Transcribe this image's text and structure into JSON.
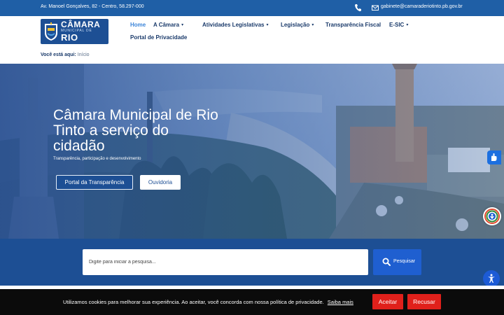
{
  "topbar": {
    "address": "Av. Manoel Gonçalves, 82 - Centro, 58.297-000",
    "email": "gabinete@camaraderiotinto.pb.gov.br",
    "icons": [
      "phone-icon",
      "mail-icon"
    ]
  },
  "logo": {
    "line1": "CÂMARA",
    "line2": "MUNICIPAL DE",
    "line3": "RIO TINTO"
  },
  "nav": {
    "items": [
      {
        "label": "Home",
        "active": true,
        "dropdown": false
      },
      {
        "label": "A Câmara",
        "dropdown": true
      },
      {
        "label": "Atividades Legislativas",
        "dropdown": true
      },
      {
        "label": "Legislação",
        "dropdown": true
      },
      {
        "label": "Transparência Fiscal",
        "dropdown": false
      },
      {
        "label": "E-SIC",
        "dropdown": true
      },
      {
        "label": "Portal de Privacidade",
        "dropdown": false
      }
    ],
    "chevron": "▾"
  },
  "breadcrumb": {
    "prefix": "Você está aqui:",
    "current": "Início"
  },
  "hero": {
    "title": "Câmara Municipal de Rio Tinto a serviço do cidadão",
    "subtitle": "Transparência, participação e desenvolvimento",
    "btn_transparency": "Portal da Transparência",
    "btn_ombudsman": "Ouvidoria"
  },
  "search": {
    "placeholder": "Digite para iniciar a pesquisa...",
    "button_label": "Pesquisar"
  },
  "cookie": {
    "text": "Utilizamos cookies para melhorar sua experiência. Ao aceitar, você concorda com nossa política de privacidade.",
    "more": "Saiba mais",
    "accept": "Aceitar",
    "reject": "Recusar"
  },
  "colors": {
    "brand_blue": "#1d4f94",
    "topbar_blue": "#1f5fa6",
    "accent_red": "#e0201b",
    "nav_active": "#3d86d9"
  }
}
